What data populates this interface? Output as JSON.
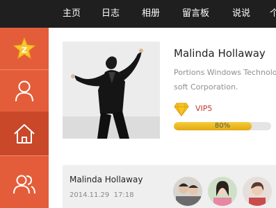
{
  "nav": {
    "items": [
      "主页",
      "日志",
      "相册",
      "留言板",
      "说说",
      "个"
    ]
  },
  "sidebar": {
    "items": [
      {
        "icon": "qzone-star-icon",
        "label": ""
      },
      {
        "icon": "user-icon",
        "label": ""
      },
      {
        "icon": "home-icon",
        "label": ""
      },
      {
        "icon": "friends-icon",
        "label": ""
      }
    ],
    "active_index": 2
  },
  "profile": {
    "name": "Malinda Hollaway",
    "description_line1": "Portions Windows Technology",
    "description_line2": "soft Corporation.",
    "vip_label": "VIP5",
    "progress_fraction": 0.8,
    "progress_text": "80%"
  },
  "feed": {
    "author": "Malinda Hollaway",
    "date": "2014.11.29",
    "time": "17:18"
  },
  "colors": {
    "topbar": "#1f1f1f",
    "sidebar": "#e45d3a",
    "sidebar_active": "#c9482a",
    "accent_red": "#c0392b",
    "progress_gold": "#e8b21a"
  }
}
